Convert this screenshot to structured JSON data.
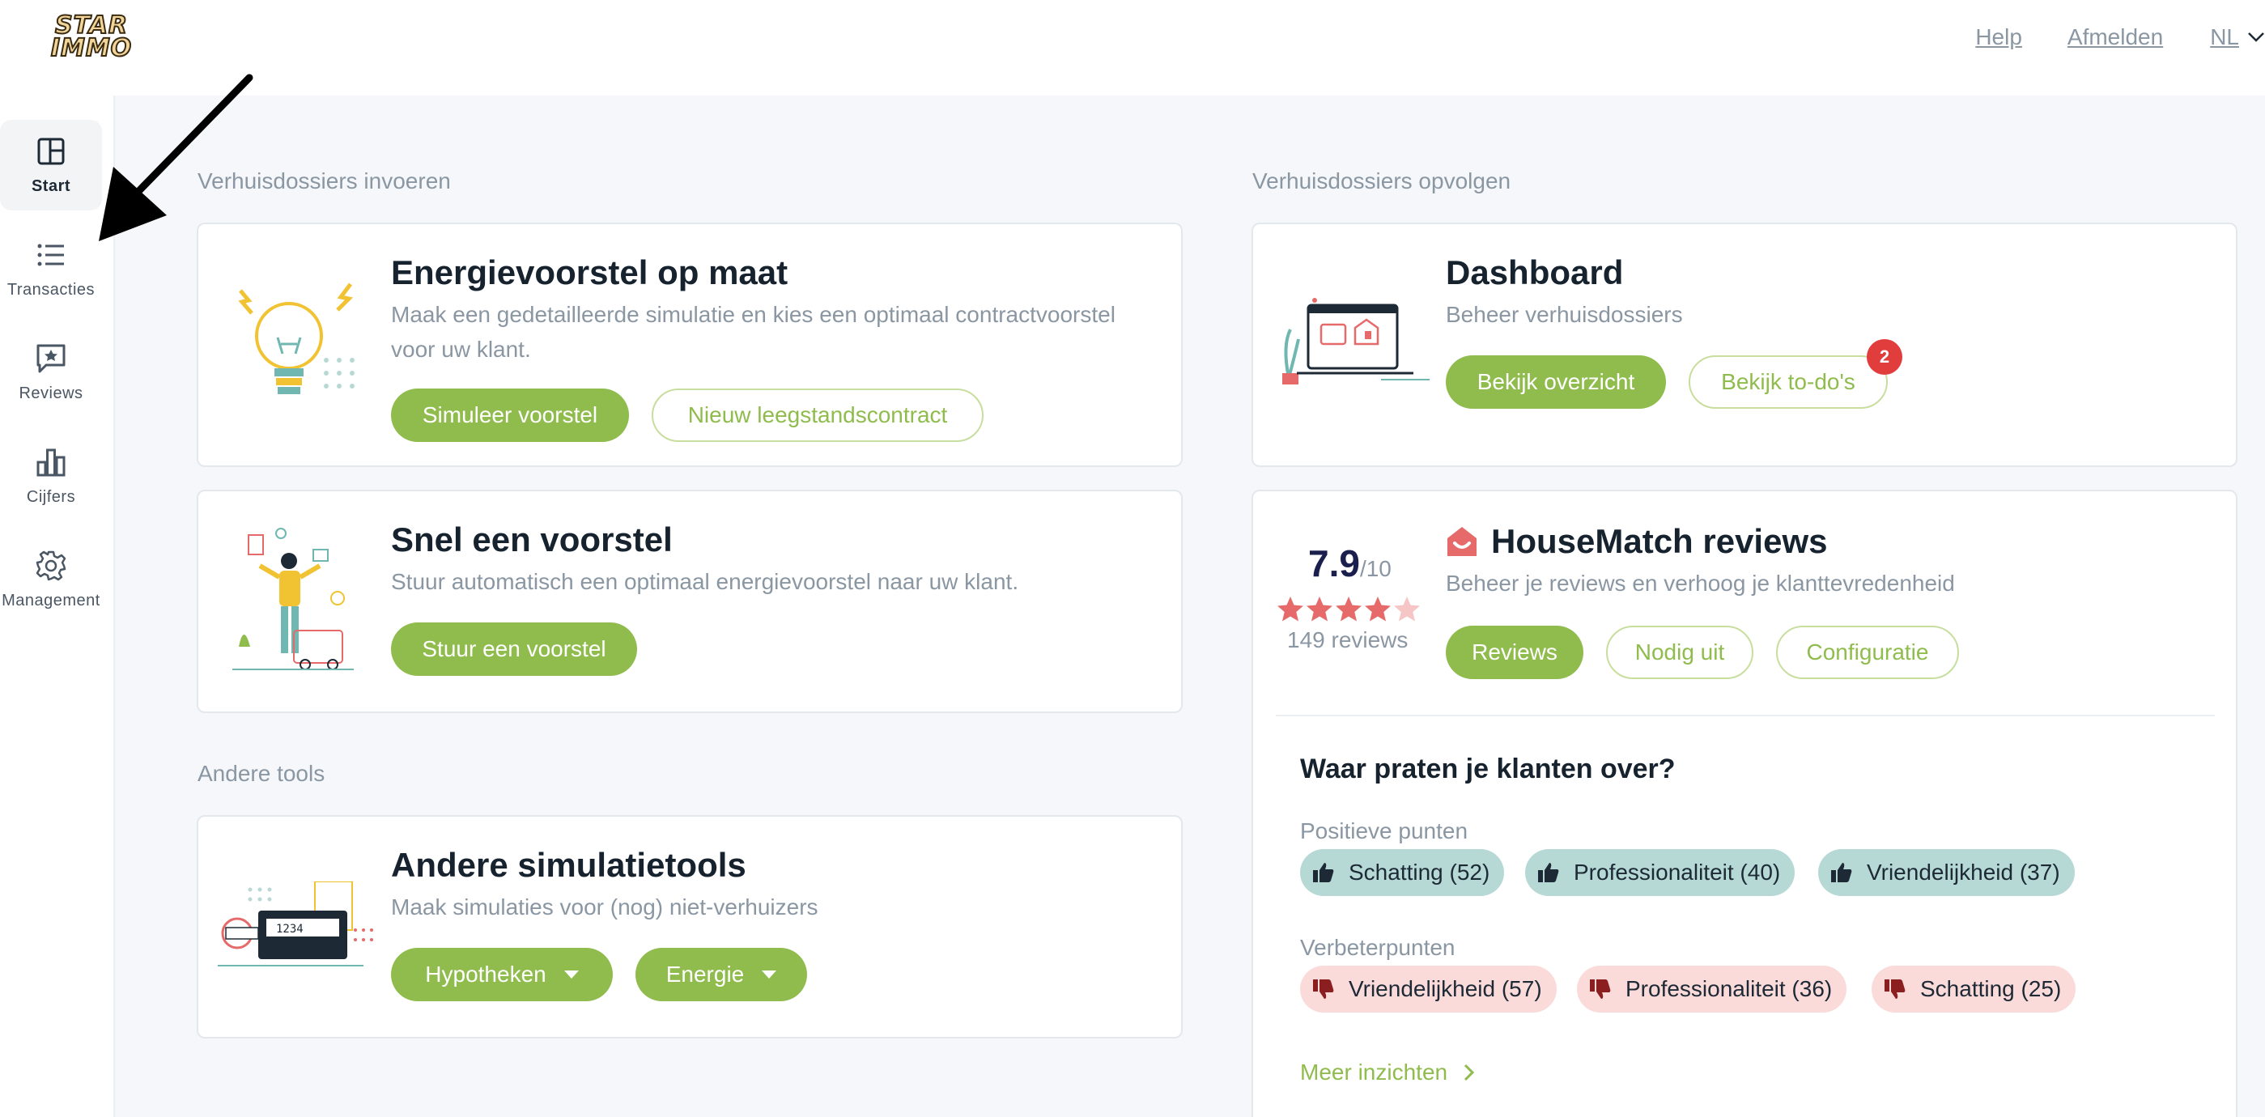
{
  "header": {
    "logo_line1": "STAR",
    "logo_line2": "IMMO",
    "help": "Help",
    "logout": "Afmelden",
    "language": "NL"
  },
  "sidebar": {
    "items": [
      {
        "label": "Start",
        "icon": "layout-icon",
        "active": true
      },
      {
        "label": "Transacties",
        "icon": "list-icon"
      },
      {
        "label": "Reviews",
        "icon": "review-icon"
      },
      {
        "label": "Cijfers",
        "icon": "bar-chart-icon"
      },
      {
        "label": "Management",
        "icon": "gear-icon"
      }
    ]
  },
  "left": {
    "section_title": "Verhuisdossiers invoeren",
    "energy": {
      "title": "Energievoorstel op maat",
      "subtitle_line1": "Maak een gedetailleerde simulatie en kies een optimaal contractvoorstel",
      "subtitle_line2": "voor uw klant.",
      "primary": "Simuleer voorstel",
      "secondary": "Nieuw leegstandscontract"
    },
    "quick": {
      "title": "Snel een voorstel",
      "subtitle": "Stuur automatisch een optimaal energievoorstel naar uw klant.",
      "primary": "Stuur een voorstel"
    },
    "other_section_title": "Andere tools",
    "other": {
      "title": "Andere simulatietools",
      "subtitle": "Maak simulaties voor (nog) niet-verhuizers",
      "btn1": "Hypotheken",
      "btn2": "Energie"
    }
  },
  "right": {
    "section_title": "Verhuisdossiers opvolgen",
    "dashboard": {
      "title": "Dashboard",
      "subtitle": "Beheer verhuisdossiers",
      "primary": "Bekijk overzicht",
      "secondary": "Bekijk to-do's",
      "badge": "2"
    },
    "reviews": {
      "rating": "7.9",
      "rating_max": "/10",
      "stars_filled": 4,
      "stars_total": 5,
      "review_count": "149 reviews",
      "title": "HouseMatch reviews",
      "subtitle": "Beheer je reviews en verhoog je klanttevredenheid",
      "btn_reviews": "Reviews",
      "btn_invite": "Nodig uit",
      "btn_config": "Configuratie",
      "talk_title": "Waar praten je klanten over?",
      "positive_label": "Positieve punten",
      "positive": [
        "Schatting (52)",
        "Professionaliteit (40)",
        "Vriendelijkheid (37)"
      ],
      "improve_label": "Verbeterpunten",
      "improve": [
        "Vriendelijkheid (57)",
        "Professionaliteit (36)",
        "Schatting (25)"
      ],
      "more": "Meer inzichten"
    }
  },
  "colors": {
    "accent_green": "#8fbc4d",
    "positive_chip": "#b6d9d6",
    "negative_chip": "#fbdada",
    "badge_red": "#e23d3d",
    "star_red": "#e66a6a"
  }
}
